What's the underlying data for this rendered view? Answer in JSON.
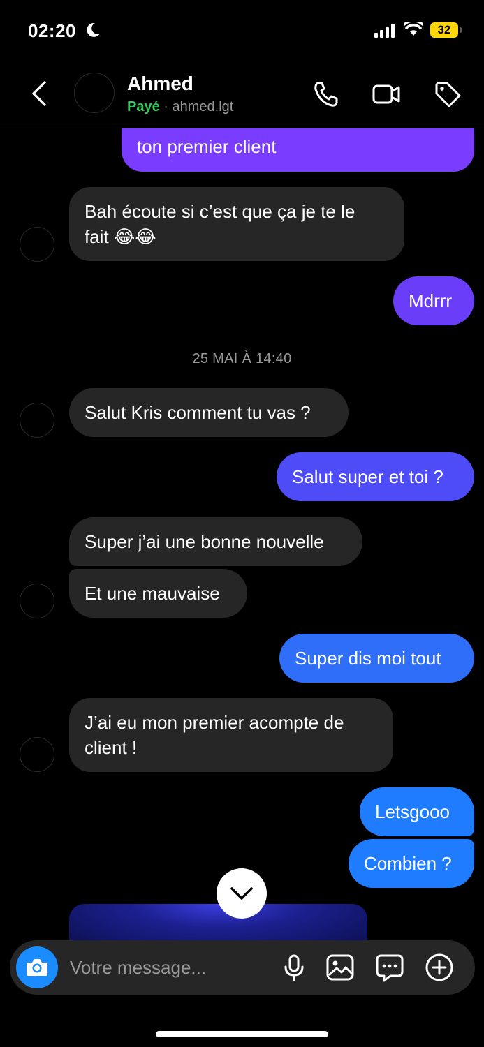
{
  "status_bar": {
    "time": "02:20",
    "battery": "32"
  },
  "header": {
    "name": "Ahmed",
    "status": "Payé",
    "separator": "·",
    "handle": "ahmed.lgt"
  },
  "messages": [
    {
      "dir": "out",
      "text": "ton premier client"
    },
    {
      "dir": "in",
      "line1": "Bah écoute si c’est que ça je te le",
      "line2": "fait 😂😂"
    },
    {
      "dir": "out",
      "text": "Mdrrr"
    },
    {
      "dir": "in",
      "text": "Salut Kris comment tu vas ?"
    },
    {
      "dir": "out",
      "text": "Salut super et toi ?"
    },
    {
      "dir": "in",
      "text": "Super j’ai une bonne nouvelle"
    },
    {
      "dir": "in",
      "text": "Et une mauvaise"
    },
    {
      "dir": "out",
      "text": "Super dis moi tout"
    },
    {
      "dir": "in",
      "line1": "J’ai eu mon premier acompte de",
      "line2": "client !"
    },
    {
      "dir": "out",
      "text": "Letsgooo"
    },
    {
      "dir": "out",
      "text": "Combien ?"
    }
  ],
  "date_separator": "25 MAI À 14:40",
  "composer": {
    "placeholder": "Votre message..."
  },
  "colors": {
    "bubble_in": "#262626",
    "bubble_out_top": "#7a3cff",
    "bubble_out_bottom": "#1f7cff",
    "paid": "#34c759",
    "camera": "#1a8cff"
  },
  "icons": [
    "back-chevron-icon",
    "phone-icon",
    "video-camera-icon",
    "tag-icon",
    "chevron-down-icon",
    "camera-icon",
    "microphone-icon",
    "image-icon",
    "sticker-chat-icon",
    "plus-circle-icon"
  ]
}
